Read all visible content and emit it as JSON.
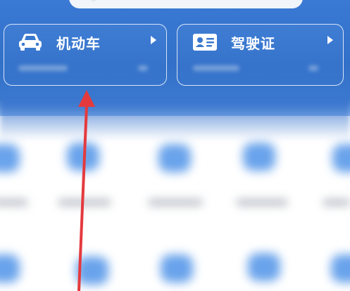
{
  "cards": {
    "vehicle": {
      "label": "机动车",
      "icon": "car-icon"
    },
    "license": {
      "label": "驾驶证",
      "icon": "id-card-icon"
    }
  },
  "colors": {
    "header_blue": "#3270c9",
    "annotation_red": "#e43a3e",
    "icon_blue": "#4f93e8"
  }
}
